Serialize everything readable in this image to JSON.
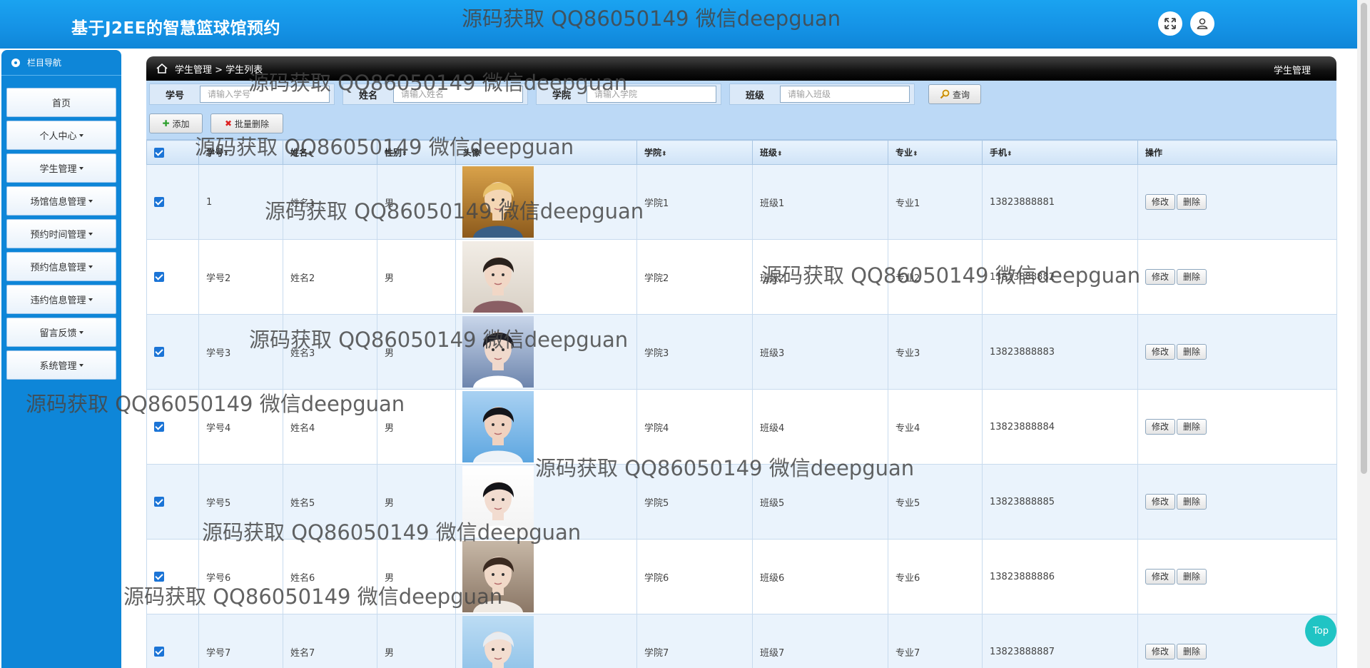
{
  "header": {
    "title": "基于J2EE的智慧篮球馆预约"
  },
  "sidebar": {
    "heading": "栏目导航",
    "items": [
      {
        "label": "首页",
        "has_caret": false
      },
      {
        "label": "个人中心",
        "has_caret": true
      },
      {
        "label": "学生管理",
        "has_caret": true
      },
      {
        "label": "场馆信息管理",
        "has_caret": true
      },
      {
        "label": "预约时间管理",
        "has_caret": true
      },
      {
        "label": "预约信息管理",
        "has_caret": true
      },
      {
        "label": "违约信息管理",
        "has_caret": true
      },
      {
        "label": "留言反馈",
        "has_caret": true
      },
      {
        "label": "系统管理",
        "has_caret": true
      }
    ]
  },
  "breadcrumb": {
    "path": "学生管理 > 学生列表",
    "right": "学生管理"
  },
  "search": {
    "fields": [
      {
        "label": "学号",
        "placeholder": "请输入学号"
      },
      {
        "label": "姓名",
        "placeholder": "请输入姓名"
      },
      {
        "label": "学院",
        "placeholder": "请输入学院"
      },
      {
        "label": "班级",
        "placeholder": "请输入班级"
      }
    ],
    "query_button": "查询"
  },
  "toolbar": {
    "add": "添加",
    "batch_delete": "批量删除"
  },
  "table": {
    "columns": [
      "学号",
      "姓名",
      "性别",
      "头像",
      "学院",
      "班级",
      "专业",
      "手机",
      "操作"
    ],
    "rows": [
      {
        "id": "1",
        "name": "姓名1",
        "gender": "男",
        "college": "学院1",
        "class": "班级1",
        "major": "专业1",
        "phone": "13823888881"
      },
      {
        "id": "学号2",
        "name": "姓名2",
        "gender": "男",
        "college": "学院2",
        "class": "班级2",
        "major": "专业2",
        "phone": "13823888882"
      },
      {
        "id": "学号3",
        "name": "姓名3",
        "gender": "男",
        "college": "学院3",
        "class": "班级3",
        "major": "专业3",
        "phone": "13823888883"
      },
      {
        "id": "学号4",
        "name": "姓名4",
        "gender": "男",
        "college": "学院4",
        "class": "班级4",
        "major": "专业4",
        "phone": "13823888884"
      },
      {
        "id": "学号5",
        "name": "姓名5",
        "gender": "男",
        "college": "学院5",
        "class": "班级5",
        "major": "专业5",
        "phone": "13823888885"
      },
      {
        "id": "学号6",
        "name": "姓名6",
        "gender": "男",
        "college": "学院6",
        "class": "班级6",
        "major": "专业6",
        "phone": "13823888886"
      },
      {
        "id": "学号7",
        "name": "姓名7",
        "gender": "男",
        "college": "学院7",
        "class": "班级7",
        "major": "专业7",
        "phone": "13823888887"
      }
    ],
    "edit_label": "修改",
    "delete_label": "删除"
  },
  "watermark": "源码获取 QQ86050149 微信deepguan",
  "top_button": "Top",
  "colors": {
    "header": "#1593e6",
    "sidebar": "#0e86d8",
    "search_panel": "#bcd9f6",
    "checkbox": "#1b74d6",
    "top_button": "#20c4c4"
  }
}
